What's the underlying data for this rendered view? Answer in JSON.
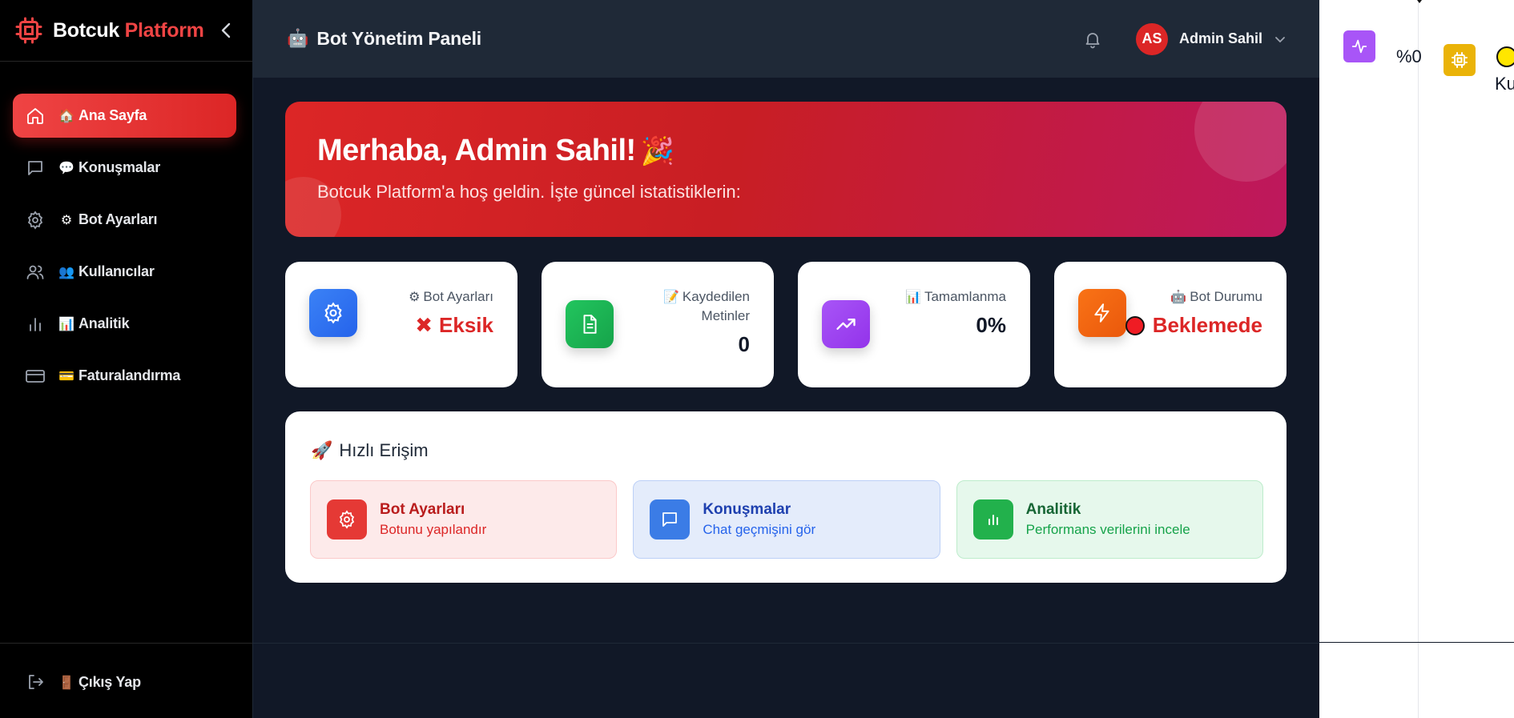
{
  "brand": {
    "name_main": "Botcuk",
    "name_accent": "Platform"
  },
  "sidebar": {
    "items": [
      {
        "emoji": "🏠",
        "label": "Ana Sayfa",
        "icon": "home-icon"
      },
      {
        "emoji": "💬",
        "label": "Konuşmalar",
        "icon": "message-icon"
      },
      {
        "emoji": "⚙",
        "label": "Bot Ayarları",
        "icon": "gear-icon"
      },
      {
        "emoji": "👥",
        "label": "Kullanıcılar",
        "icon": "users-icon"
      },
      {
        "emoji": "📊",
        "label": "Analitik",
        "icon": "bar-chart-icon"
      },
      {
        "emoji": "💳",
        "label": "Faturalandırma",
        "icon": "credit-card-icon"
      }
    ],
    "logout": {
      "emoji": "🚪",
      "label": "Çıkış Yap"
    }
  },
  "header": {
    "emoji": "🤖",
    "title": "Bot Yönetim Paneli",
    "user_initials": "AS",
    "user_name": "Admin Sahil"
  },
  "hero": {
    "title": "Merhaba, Admin Sahil!",
    "emoji": "🎉",
    "subtitle": "Botcuk Platform'a hoş geldin. İşte güncel istatistiklerin:"
  },
  "stats": [
    {
      "emoji": "⚙",
      "label": "Bot Ayarları",
      "value": "Eksik",
      "mark": "✖",
      "icon": "gear-icon"
    },
    {
      "emoji": "📝",
      "label_line1": "Kaydedilen",
      "label_line2": "Metinler",
      "value": "0",
      "icon": "document-icon"
    },
    {
      "emoji": "📊",
      "label": "Tamamlanma",
      "value": "0%",
      "icon": "trending-up-icon"
    },
    {
      "emoji": "🤖",
      "label": "Bot Durumu",
      "value": "Beklemede",
      "icon": "lightning-icon"
    }
  ],
  "quick_access": {
    "emoji": "🚀",
    "title": "Hızlı Erişim",
    "cards": [
      {
        "title": "Bot Ayarları",
        "desc": "Botunu yapılandır",
        "icon": "gear-icon"
      },
      {
        "title": "Konuşmalar",
        "desc": "Chat geçmişini gör",
        "icon": "message-icon"
      },
      {
        "title": "Analitik",
        "desc": "Performans verilerini incele",
        "icon": "bar-chart-icon"
      }
    ]
  },
  "right_panel": {
    "text1": "%0",
    "text2": "Ku"
  },
  "colors": {
    "accent": "#ef4444",
    "sidebar_bg": "#000000",
    "header_bg": "#1f2937",
    "main_bg": "#111827"
  }
}
